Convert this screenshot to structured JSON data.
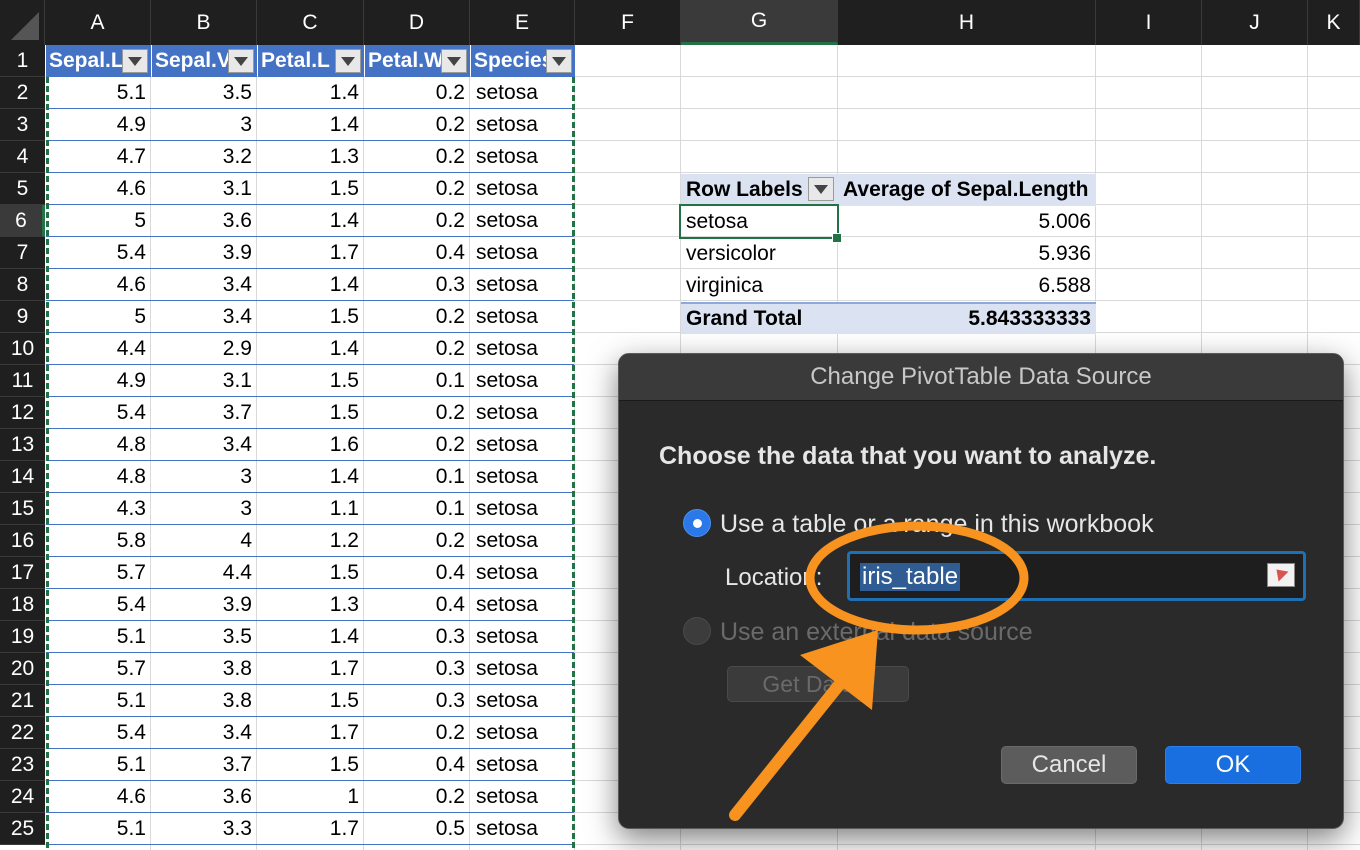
{
  "columns": [
    "A",
    "B",
    "C",
    "D",
    "E",
    "F",
    "G",
    "H",
    "I",
    "J",
    "K"
  ],
  "rows": [
    "1",
    "2",
    "3",
    "4",
    "5",
    "6",
    "7",
    "8",
    "9",
    "10",
    "11",
    "12",
    "13",
    "14",
    "15",
    "16",
    "17",
    "18",
    "19",
    "20",
    "21",
    "22",
    "23",
    "24",
    "25"
  ],
  "table": {
    "headers": [
      "Sepal.L",
      "Sepal.V",
      "Petal.L",
      "Petal.W",
      "Species"
    ],
    "data": [
      [
        "5.1",
        "3.5",
        "1.4",
        "0.2",
        "setosa"
      ],
      [
        "4.9",
        "3",
        "1.4",
        "0.2",
        "setosa"
      ],
      [
        "4.7",
        "3.2",
        "1.3",
        "0.2",
        "setosa"
      ],
      [
        "4.6",
        "3.1",
        "1.5",
        "0.2",
        "setosa"
      ],
      [
        "5",
        "3.6",
        "1.4",
        "0.2",
        "setosa"
      ],
      [
        "5.4",
        "3.9",
        "1.7",
        "0.4",
        "setosa"
      ],
      [
        "4.6",
        "3.4",
        "1.4",
        "0.3",
        "setosa"
      ],
      [
        "5",
        "3.4",
        "1.5",
        "0.2",
        "setosa"
      ],
      [
        "4.4",
        "2.9",
        "1.4",
        "0.2",
        "setosa"
      ],
      [
        "4.9",
        "3.1",
        "1.5",
        "0.1",
        "setosa"
      ],
      [
        "5.4",
        "3.7",
        "1.5",
        "0.2",
        "setosa"
      ],
      [
        "4.8",
        "3.4",
        "1.6",
        "0.2",
        "setosa"
      ],
      [
        "4.8",
        "3",
        "1.4",
        "0.1",
        "setosa"
      ],
      [
        "4.3",
        "3",
        "1.1",
        "0.1",
        "setosa"
      ],
      [
        "5.8",
        "4",
        "1.2",
        "0.2",
        "setosa"
      ],
      [
        "5.7",
        "4.4",
        "1.5",
        "0.4",
        "setosa"
      ],
      [
        "5.4",
        "3.9",
        "1.3",
        "0.4",
        "setosa"
      ],
      [
        "5.1",
        "3.5",
        "1.4",
        "0.3",
        "setosa"
      ],
      [
        "5.7",
        "3.8",
        "1.7",
        "0.3",
        "setosa"
      ],
      [
        "5.1",
        "3.8",
        "1.5",
        "0.3",
        "setosa"
      ],
      [
        "5.4",
        "3.4",
        "1.7",
        "0.2",
        "setosa"
      ],
      [
        "5.1",
        "3.7",
        "1.5",
        "0.4",
        "setosa"
      ],
      [
        "4.6",
        "3.6",
        "1",
        "0.2",
        "setosa"
      ],
      [
        "5.1",
        "3.3",
        "1.7",
        "0.5",
        "setosa"
      ]
    ]
  },
  "pivot": {
    "row_labels_header": "Row Labels",
    "value_header": "Average of Sepal.Length",
    "rows": [
      {
        "label": "setosa",
        "value": "5.006"
      },
      {
        "label": "versicolor",
        "value": "5.936"
      },
      {
        "label": "virginica",
        "value": "6.588"
      }
    ],
    "total_label": "Grand Total",
    "total_value": "5.843333333"
  },
  "dialog": {
    "title": "Change PivotTable Data Source",
    "heading": "Choose the data that you want to analyze.",
    "option_table": "Use a table or a range in this workbook",
    "location_label": "Location:",
    "location_value": "iris_table",
    "option_external": "Use an external data source",
    "get_data_label": "Get Data...",
    "cancel_label": "Cancel",
    "ok_label": "OK"
  },
  "colors": {
    "selection_green": "#217346",
    "table_header_blue": "#4472c4",
    "annotation_orange": "#f7931e",
    "ok_blue": "#1a6fe0"
  }
}
